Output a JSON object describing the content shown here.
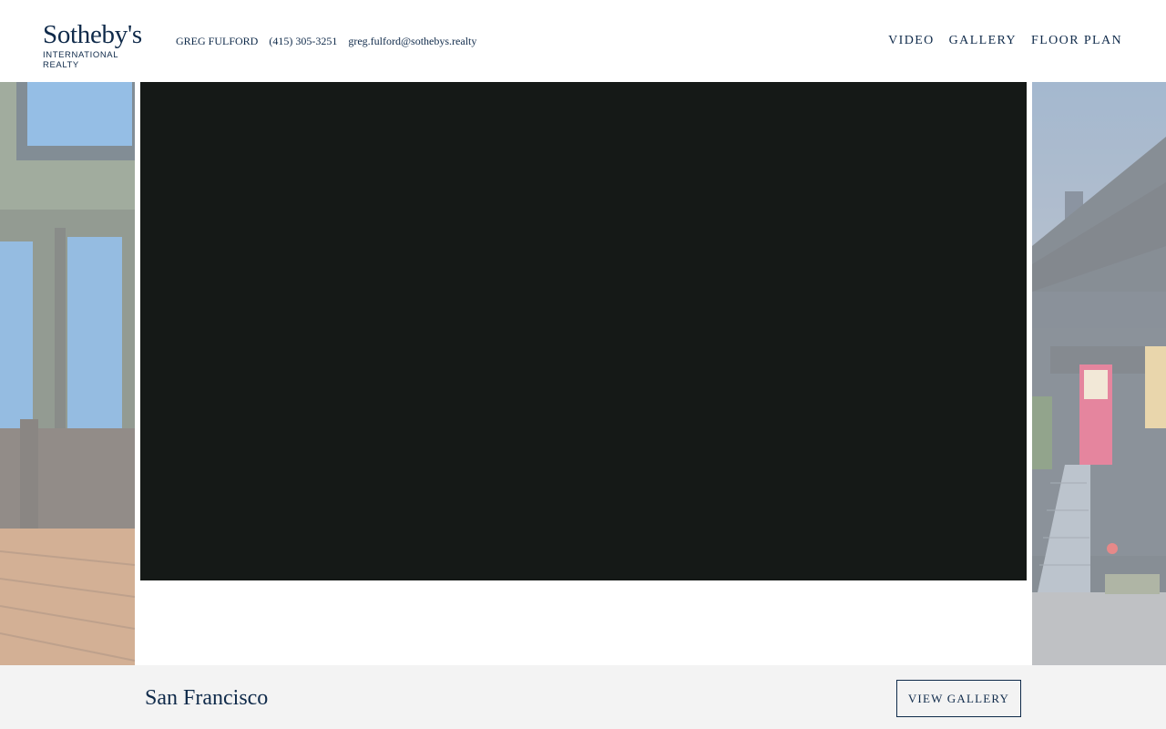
{
  "brand": {
    "name": "Sotheby's",
    "subtitle": "INTERNATIONAL REALTY",
    "color": "#0f2a4a"
  },
  "agent": {
    "name": "GREG FULFORD",
    "phone": "(415) 305-3251",
    "email": "greg.fulford@sothebys.realty"
  },
  "nav": {
    "items": [
      "VIDEO",
      "GALLERY",
      "FLOOR PLAN"
    ]
  },
  "carousel": {
    "video_background": "#151917"
  },
  "footer": {
    "city": "San Francisco",
    "button_label": "VIEW GALLERY",
    "background": "#f3f3f3"
  }
}
